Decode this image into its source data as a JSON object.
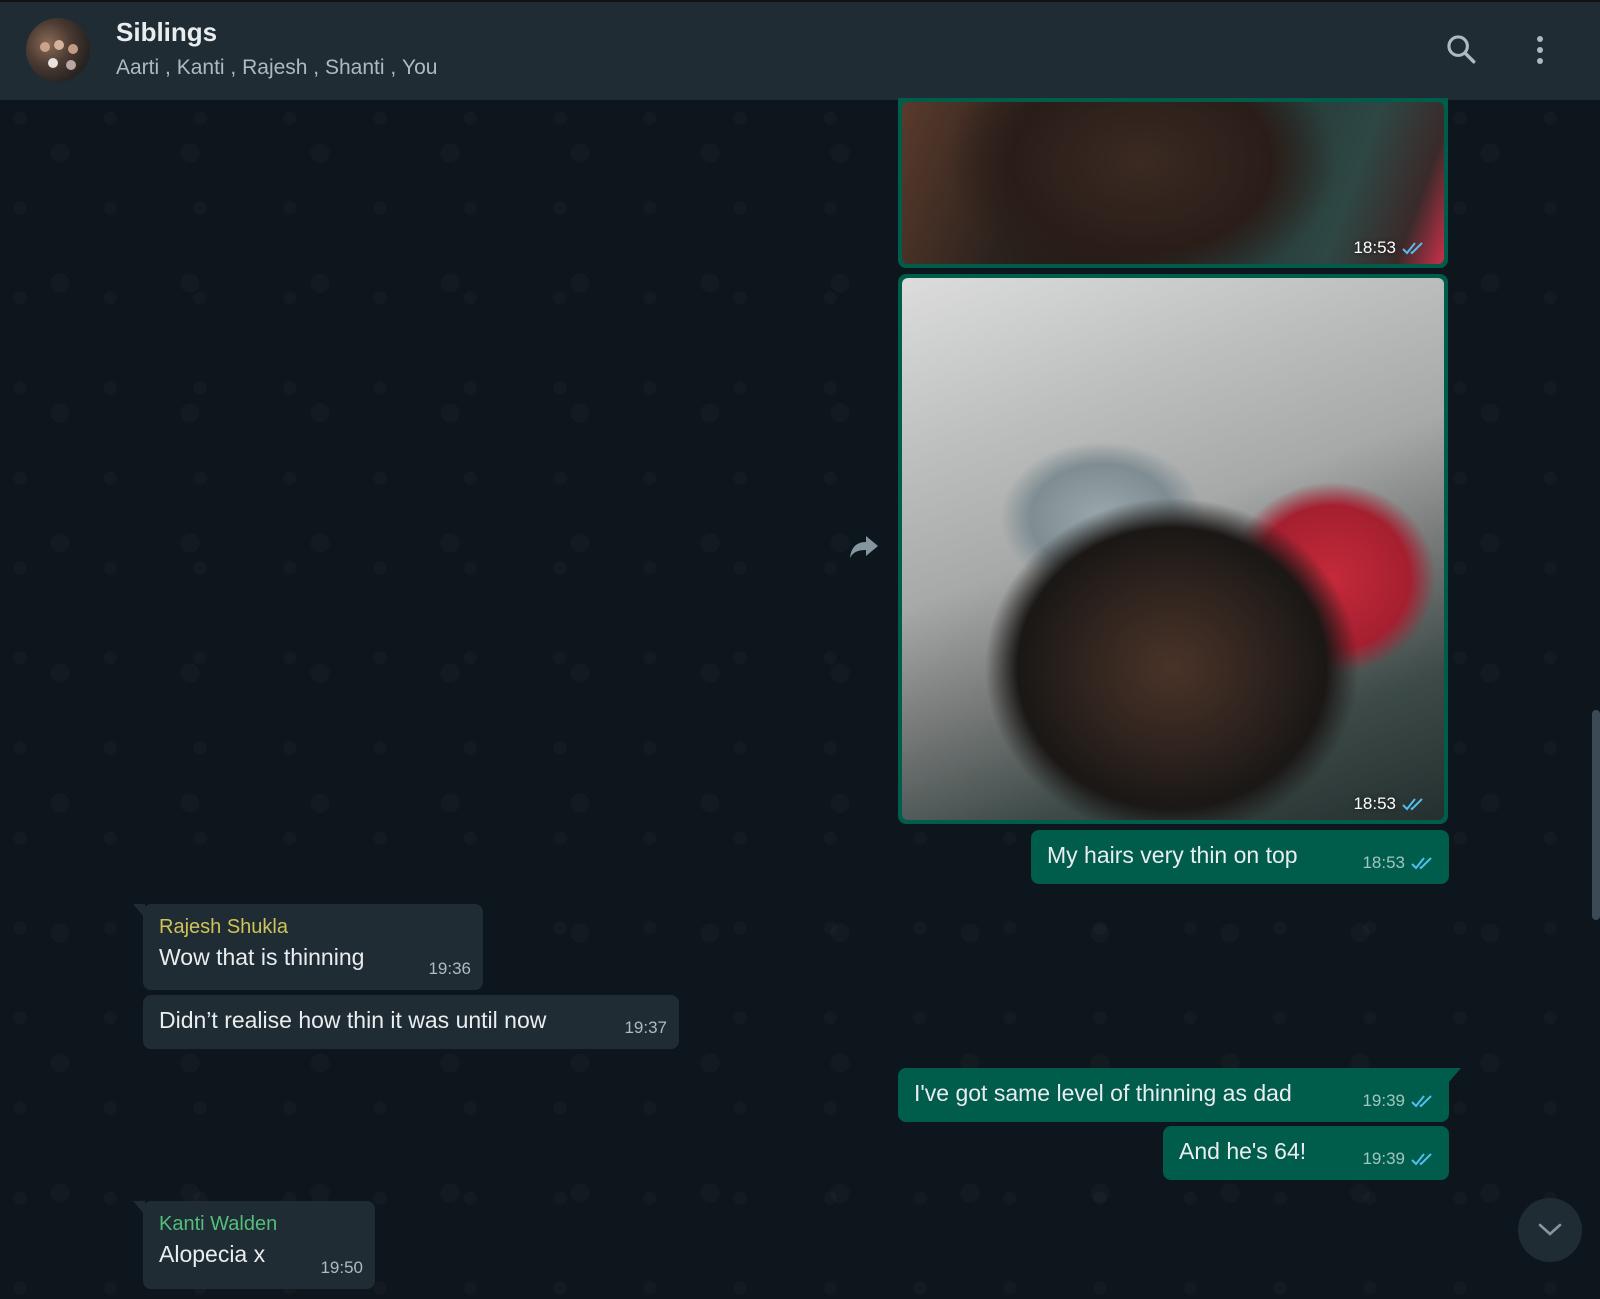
{
  "header": {
    "title": "Siblings",
    "members": [
      "Aarti",
      "Kanti",
      "Rajesh",
      "Shanti",
      "You"
    ],
    "separator": " , "
  },
  "messages": {
    "img1": {
      "time": "18:53",
      "status": "read"
    },
    "img2": {
      "time": "18:53",
      "status": "read"
    },
    "m1": {
      "text": "My hairs very thin on top",
      "time": "18:53",
      "status": "read"
    },
    "m2": {
      "sender": "Rajesh Shukla",
      "sender_color": "#d1c25a",
      "text": "Wow that is thinning",
      "time": "19:36"
    },
    "m3": {
      "text": "Didn’t realise how thin it was until now",
      "time": "19:37"
    },
    "m4": {
      "text": "I've got same level of thinning as dad",
      "time": "19:39",
      "status": "read"
    },
    "m5": {
      "text": "And he's 64!",
      "time": "19:39",
      "status": "read"
    },
    "m6": {
      "sender": "Kanti Walden",
      "sender_color": "#53bd7b",
      "text": "Alopecia x",
      "time": "19:50"
    }
  },
  "colors": {
    "outgoing_bubble": "#005c4b",
    "incoming_bubble": "#202c33",
    "header": "#202c33",
    "read_ticks": "#53bdeb"
  },
  "icons": {
    "search": "search-icon",
    "menu": "more-vertical-icon",
    "forward": "forward-icon",
    "scroll_down": "chevron-down-icon"
  }
}
